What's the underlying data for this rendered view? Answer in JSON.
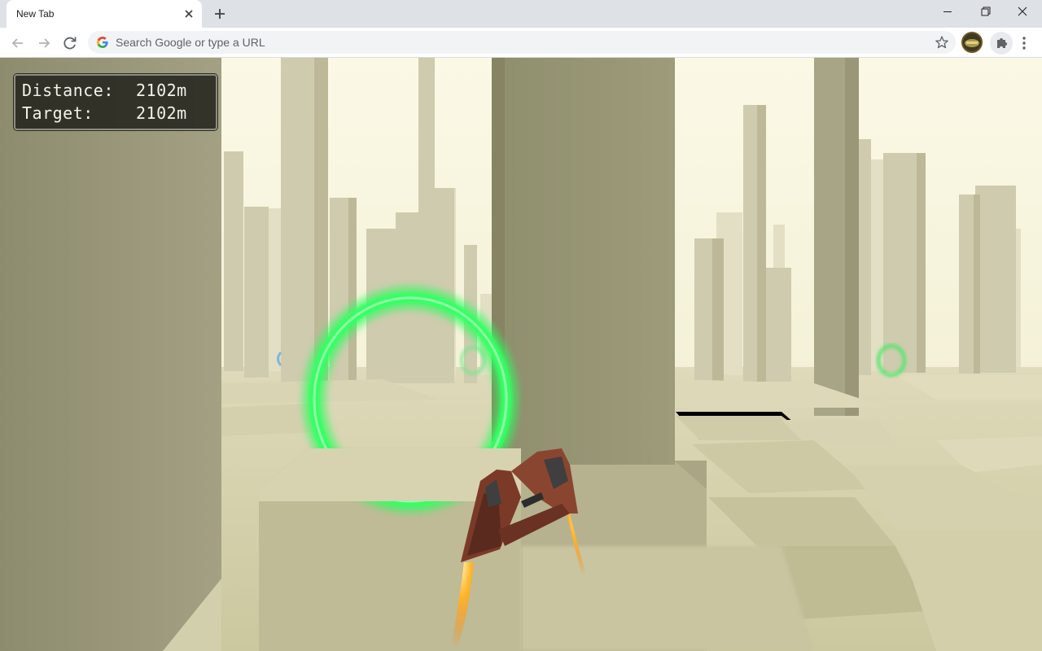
{
  "browser": {
    "tab": {
      "title": "New Tab"
    },
    "omnibox": {
      "placeholder": "Search Google or type a URL",
      "value": ""
    }
  },
  "hud": {
    "distance_label": "Distance:",
    "distance_value": "2102m",
    "target_label": "Target:",
    "target_value": "2102m"
  },
  "icons": {
    "tab_close": "close-icon",
    "new_tab": "plus-icon",
    "minimize": "minimize-icon",
    "maximize": "restore-icon",
    "close_window": "close-icon",
    "back": "arrow-left-icon",
    "forward": "arrow-right-icon",
    "reload": "reload-icon",
    "google": "google-g-icon",
    "bookmark": "star-icon",
    "extensions": "puzzle-icon",
    "menu": "kebab-menu-icon"
  },
  "colors": {
    "ring": "#2aff5a",
    "sky": "#f6f3dc",
    "ship": "#7a3a28",
    "flame": "#ffb22a"
  }
}
